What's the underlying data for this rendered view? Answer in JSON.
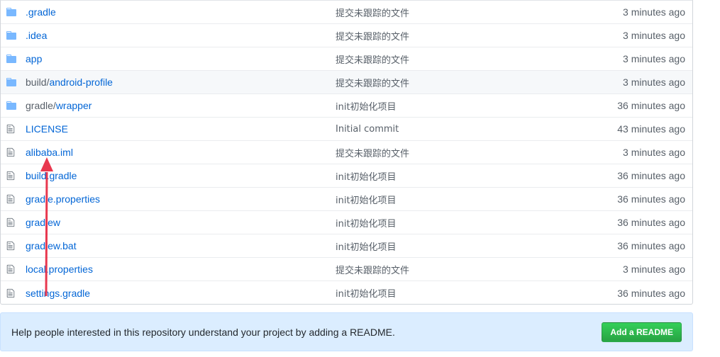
{
  "files": [
    {
      "type": "dir",
      "prefix": "",
      "name": ".gradle",
      "message": "提交未跟踪的文件",
      "age": "3 minutes ago"
    },
    {
      "type": "dir",
      "prefix": "",
      "name": ".idea",
      "message": "提交未跟踪的文件",
      "age": "3 minutes ago"
    },
    {
      "type": "dir",
      "prefix": "",
      "name": "app",
      "message": "提交未跟踪的文件",
      "age": "3 minutes ago"
    },
    {
      "type": "dir",
      "prefix": "build/",
      "name": "android-profile",
      "message": "提交未跟踪的文件",
      "age": "3 minutes ago"
    },
    {
      "type": "dir",
      "prefix": "gradle/",
      "name": "wrapper",
      "message": "init初始化项目",
      "age": "36 minutes ago"
    },
    {
      "type": "file",
      "prefix": "",
      "name": "LICENSE",
      "message": "Initial commit",
      "age": "43 minutes ago"
    },
    {
      "type": "file",
      "prefix": "",
      "name": "alibaba.iml",
      "message": "提交未跟踪的文件",
      "age": "3 minutes ago"
    },
    {
      "type": "file",
      "prefix": "",
      "name": "build.gradle",
      "message": "init初始化项目",
      "age": "36 minutes ago"
    },
    {
      "type": "file",
      "prefix": "",
      "name": "gradle.properties",
      "message": "init初始化项目",
      "age": "36 minutes ago"
    },
    {
      "type": "file",
      "prefix": "",
      "name": "gradlew",
      "message": "init初始化项目",
      "age": "36 minutes ago"
    },
    {
      "type": "file",
      "prefix": "",
      "name": "gradlew.bat",
      "message": "init初始化项目",
      "age": "36 minutes ago"
    },
    {
      "type": "file",
      "prefix": "",
      "name": "local.properties",
      "message": "提交未跟踪的文件",
      "age": "3 minutes ago"
    },
    {
      "type": "file",
      "prefix": "",
      "name": "settings.gradle",
      "message": "init初始化项目",
      "age": "36 minutes ago"
    }
  ],
  "hover_row_index": 3,
  "readme": {
    "text": "Help people interested in this repository understand your project by adding a README.",
    "button_label": "Add a README"
  },
  "colors": {
    "link": "#0366d6",
    "muted": "#586069",
    "folder_icon": "#79b8ff",
    "file_icon": "#6a737d",
    "annotation_arrow": "#e8384f",
    "button_green": "#28a745",
    "banner_bg": "#dbedff"
  },
  "icons": {
    "dir": "folder-icon",
    "file": "file-icon"
  }
}
